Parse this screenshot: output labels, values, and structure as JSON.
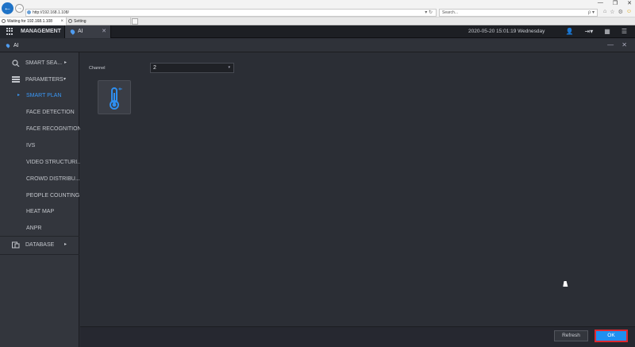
{
  "browser": {
    "address": "http://192.168.1.108/",
    "address_tools": "▾ ↻",
    "search_placeholder": "Search...",
    "search_tools": "ρ ▾",
    "tabs": [
      {
        "label": "Waiting for 192.168.1.108"
      },
      {
        "label": "Setting"
      }
    ],
    "window_controls": [
      "—",
      "❐",
      "✕"
    ],
    "tool_icons": [
      "⌂",
      "☆",
      "⚙",
      "☺"
    ]
  },
  "header": {
    "management_label": "MANAGEMENT",
    "tab_label": "AI",
    "tab_close": "✕",
    "datetime": "2020-05-20 15:01:19 Wednesday",
    "icons": [
      "user-icon",
      "logout-icon",
      "layout-icon",
      "menu-icon"
    ],
    "icon_glyphs": [
      "👤",
      "⇥▾",
      "▦",
      "☰"
    ]
  },
  "subheader": {
    "title": "AI",
    "controls": "— ✕"
  },
  "sidebar": {
    "items": [
      {
        "label": "SMART SEA...",
        "arrow": "▸"
      },
      {
        "label": "PARAMETERS",
        "arrow": "▾"
      },
      {
        "label": "SMART PLAN",
        "marker": "▸"
      },
      {
        "label": "FACE DETECTION"
      },
      {
        "label": "FACE RECOGNITION"
      },
      {
        "label": "IVS"
      },
      {
        "label": "VIDEO STRUCTURI..."
      },
      {
        "label": "CROWD DISTRIBU..."
      },
      {
        "label": "PEOPLE COUNTING"
      },
      {
        "label": "HEAT MAP"
      },
      {
        "label": "ANPR"
      },
      {
        "label": "DATABASE",
        "arrow": "▸"
      }
    ]
  },
  "main": {
    "channel_label": "Channel",
    "channel_value": "2",
    "channel_caret": "▾",
    "card_icon": "thermometer-icon"
  },
  "footer": {
    "refresh_label": "Refresh",
    "ok_label": "OK"
  },
  "colors": {
    "accent": "#1f8ff0",
    "selected_text": "#3a97f5",
    "ok_highlight": "#e0282f",
    "background": "#2b2e35"
  }
}
